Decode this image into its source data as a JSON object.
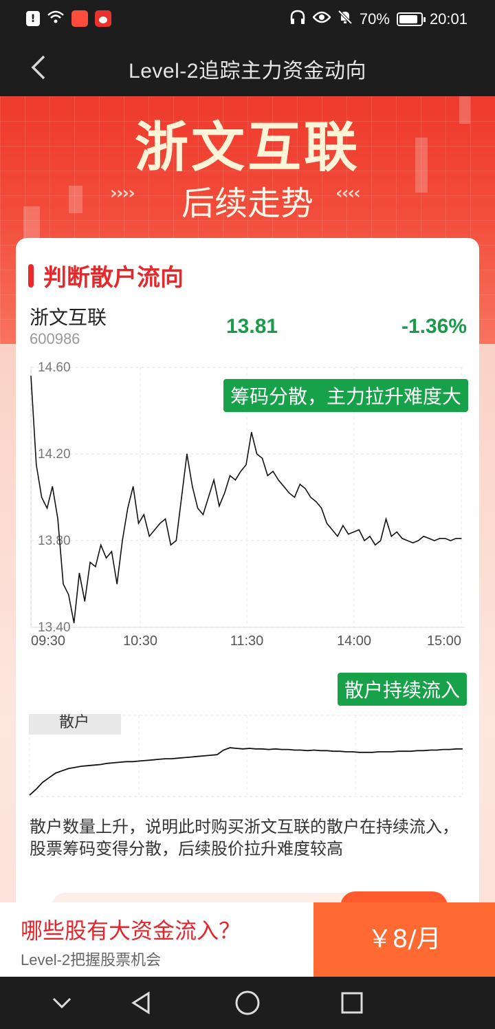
{
  "status_bar": {
    "battery": "70%",
    "time": "20:01"
  },
  "header": {
    "title": "Level-2追踪主力资金动向"
  },
  "hero": {
    "stock_name": "浙文互联",
    "subtitle": "后续走势",
    "arrows_left": "››››",
    "arrows_right": "‹‹‹‹"
  },
  "section": {
    "title": "判断散户流向"
  },
  "stock": {
    "name": "浙文互联",
    "code": "600986",
    "price": "13.81",
    "change": "-1.36%",
    "change_color": "#1a9b4a"
  },
  "chart_data": {
    "type": "line",
    "title": "",
    "y_ticks": [
      "14.60",
      "14.20",
      "13.80",
      "13.40"
    ],
    "ylim": [
      13.4,
      14.6
    ],
    "x_ticks": [
      "09:30",
      "10:30",
      "11:30",
      "14:00",
      "15:00"
    ],
    "annotation": "筹码分散，主力拉升难度大",
    "series": [
      {
        "x": [
          "09:30",
          "09:33",
          "09:36",
          "09:39",
          "09:42",
          "09:45",
          "09:48",
          "09:51",
          "09:54",
          "09:57",
          "10:00",
          "10:03",
          "10:06",
          "10:09",
          "10:12",
          "10:15",
          "10:18",
          "10:21",
          "10:24",
          "10:27",
          "10:30",
          "10:33",
          "10:36",
          "10:39",
          "10:42",
          "10:45",
          "10:48",
          "10:51",
          "10:54",
          "10:57",
          "11:00",
          "11:03",
          "11:06",
          "11:09",
          "11:12",
          "11:15",
          "11:18",
          "11:21",
          "11:24",
          "11:27",
          "11:30",
          "13:03",
          "13:06",
          "13:09",
          "13:12",
          "13:15",
          "13:18",
          "13:21",
          "13:24",
          "13:27",
          "13:30",
          "13:33",
          "13:36",
          "13:39",
          "13:42",
          "13:45",
          "13:48",
          "13:51",
          "13:54",
          "13:57",
          "14:00",
          "14:03",
          "14:06",
          "14:09",
          "14:12",
          "14:15",
          "14:18",
          "14:21",
          "14:24",
          "14:27",
          "14:30",
          "14:33",
          "14:36",
          "14:39",
          "14:42",
          "14:45",
          "14:48",
          "14:51",
          "14:54",
          "14:57",
          "15:00"
        ],
        "values": [
          14.56,
          14.15,
          14.0,
          13.95,
          14.05,
          13.9,
          13.6,
          13.55,
          13.42,
          13.65,
          13.52,
          13.7,
          13.68,
          13.78,
          13.72,
          13.75,
          13.6,
          13.8,
          13.95,
          14.05,
          13.88,
          13.92,
          13.82,
          13.85,
          13.88,
          13.9,
          13.78,
          13.8,
          14.0,
          14.2,
          14.05,
          13.95,
          13.92,
          14.0,
          14.08,
          13.96,
          14.02,
          14.1,
          14.08,
          14.12,
          14.15,
          14.3,
          14.2,
          14.18,
          14.1,
          14.12,
          14.08,
          14.05,
          14.02,
          14.0,
          14.06,
          14.04,
          14.0,
          13.98,
          13.95,
          13.88,
          13.85,
          13.82,
          13.87,
          13.83,
          13.84,
          13.85,
          13.8,
          13.82,
          13.78,
          13.8,
          13.9,
          13.82,
          13.84,
          13.81,
          13.8,
          13.79,
          13.8,
          13.82,
          13.81,
          13.8,
          13.81,
          13.81,
          13.8,
          13.81,
          13.81
        ]
      }
    ]
  },
  "retail": {
    "tag": "散户持续流入",
    "label": "散户",
    "values": [
      0.0,
      0.1,
      0.22,
      0.3,
      0.38,
      0.42,
      0.46,
      0.48,
      0.5,
      0.51,
      0.52,
      0.53,
      0.55,
      0.56,
      0.57,
      0.58,
      0.58,
      0.59,
      0.6,
      0.61,
      0.62,
      0.63,
      0.63,
      0.64,
      0.65,
      0.66,
      0.67,
      0.68,
      0.69,
      0.7,
      0.78,
      0.82,
      0.81,
      0.8,
      0.81,
      0.8,
      0.8,
      0.79,
      0.8,
      0.79,
      0.79,
      0.78,
      0.78,
      0.77,
      0.78,
      0.77,
      0.77,
      0.76,
      0.76,
      0.75,
      0.75,
      0.74,
      0.74,
      0.74,
      0.75,
      0.75,
      0.75,
      0.76,
      0.76,
      0.76,
      0.77,
      0.77,
      0.78,
      0.78,
      0.79,
      0.79,
      0.8,
      0.8
    ]
  },
  "description": "散户数量上升，说明此时购买浙文互联的散户在持续流入，股票筹码变得分散，后续股价拉升难度较高",
  "bottom": {
    "title": "哪些股有大资金流入？",
    "subtitle": "Level-2把握股票机会",
    "price": "￥8/月"
  }
}
